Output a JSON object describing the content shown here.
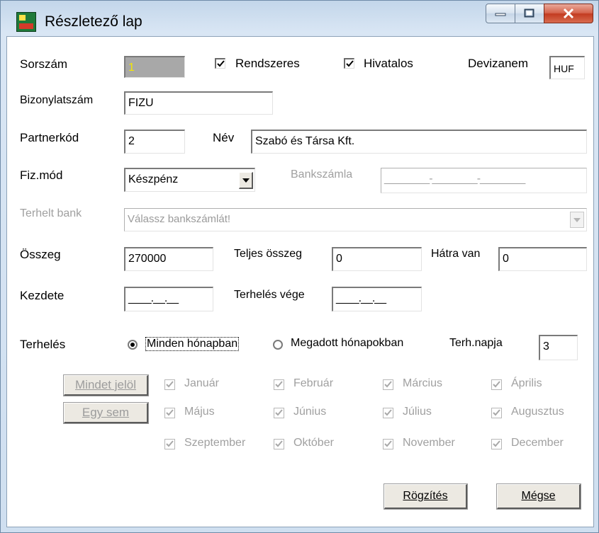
{
  "window": {
    "title": "Részletező lap"
  },
  "fields": {
    "sorszam": {
      "label": "Sorszám",
      "value": "1"
    },
    "rendszeres": {
      "label": "Rendszeres",
      "checked": true
    },
    "hivatalos": {
      "label": "Hivatalos",
      "checked": true
    },
    "devizanem": {
      "label": "Devizanem",
      "value": "HUF"
    },
    "bizonylatszam": {
      "label": "Bizonylatszám",
      "value": "FIZU"
    },
    "partnerkod": {
      "label": "Partnerkód",
      "value": "2"
    },
    "nev": {
      "label": "Név",
      "value": "Szabó és Társa Kft."
    },
    "fizmod": {
      "label": "Fiz.mód",
      "value": "Készpénz"
    },
    "bankszamla": {
      "label": "Bankszámla",
      "value": "________-________-________"
    },
    "terhelt_bank": {
      "label": "Terhelt bank",
      "value": "Válassz bankszámlát!"
    },
    "osszeg": {
      "label": "Összeg",
      "value": "270000"
    },
    "teljes_osszeg": {
      "label": "Teljes összeg",
      "value": "0"
    },
    "hatra_van": {
      "label": "Hátra van",
      "value": "0"
    },
    "kezdete": {
      "label": "Kezdete",
      "value": "____.__.__"
    },
    "terheles_vege": {
      "label": "Terhelés vége",
      "value": "____.__.__"
    },
    "terheles": {
      "label": "Terhelés",
      "option1": "Minden hónapban",
      "option2": "Megadott hónapokban",
      "selected": "option1"
    },
    "terh_napja": {
      "label": "Terh.napja",
      "value": "3"
    }
  },
  "months": {
    "select_all": "Mindet jelöl",
    "select_none": "Egy sem",
    "items": [
      "Január",
      "Február",
      "Március",
      "Április",
      "Május",
      "Június",
      "Július",
      "Augusztus",
      "Szeptember",
      "Október",
      "November",
      "December"
    ]
  },
  "buttons": {
    "save": "Rögzítés",
    "cancel": "Mégse"
  }
}
